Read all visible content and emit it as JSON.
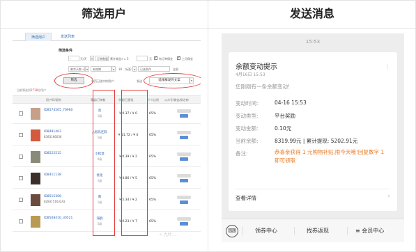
{
  "headers": {
    "left": "筛选用户",
    "right": "发送消息"
  },
  "admin": {
    "tabs": [
      "筛选用户",
      "发送列表"
    ],
    "section_title": "筛选条件",
    "fields": {
      "f1": "-",
      "f1_suffix": "元/天",
      "f2": "订单数量",
      "f2_label": "累计收益>= 5",
      "chk_label_1": "有订单佣金",
      "chk_label_2": "上月佣金",
      "f3": "剩余天数 <",
      "f4": "有效期",
      "f4_label": "已选条件",
      "f5": "30",
      "f6": "标签:",
      "f7": "全部"
    },
    "filter_button": "筛选",
    "filter_hint": "本页已选中的用户:",
    "send_label": "发送",
    "send_button": "选择群发的文案",
    "count_prefix": "当前筛选到",
    "count_value": "2718",
    "count_suffix": "位用户",
    "columns": [
      "用户ID/昵称",
      "等级/订单数",
      "余额/已提现",
      "个人比例",
      "公众号/微信/群名称"
    ],
    "rows": [
      {
        "id": "ID8574565_70960",
        "name": "",
        "level": "高",
        "orders": "1级",
        "balance": "¥ 9.37 / ¥ 0",
        "pct": "65%",
        "avatar": "#c7a08a"
      },
      {
        "id": "ID8491463",
        "name": "8383166036",
        "level": "入股队团队",
        "orders": "5级",
        "balance": "¥ 11.72 / ¥ 0",
        "pct": "65%",
        "avatar": "#d35a3e"
      },
      {
        "id": "ID8522515",
        "name": "",
        "level": "小松鼠",
        "orders": "0级",
        "balance": "¥ 0.39 / ¥ 2",
        "pct": "65%",
        "avatar": "#8a8a7a"
      },
      {
        "id": "ID8411138",
        "name": "",
        "level": "优化",
        "orders": "1级",
        "balance": "¥ 4.86 / ¥ 5",
        "pct": "65%",
        "avatar": "#3c2e2a"
      },
      {
        "id": "ID8515308",
        "name": "8283151632A2",
        "level": "南",
        "orders": "1级",
        "balance": "¥ 5.34 / ¥ 2",
        "pct": "65%",
        "avatar": "#6b4b3e"
      },
      {
        "id": "ID8508410_30521",
        "name": "",
        "level": "海鸥",
        "orders": "5级",
        "balance": "¥ 0.23 / ¥ 7",
        "pct": "65%",
        "avatar": "#b89a54"
      }
    ],
    "watermark": "✧ 九叶..."
  },
  "message": {
    "time": "15:53",
    "title": "余额变动提示",
    "date": "4月16日 15:53",
    "desc": "您刚刚有一条余额变动!",
    "fields": [
      {
        "label": "变动时间:",
        "value": "04-16 15:53"
      },
      {
        "label": "变动类型:",
        "value": "平台奖励"
      },
      {
        "label": "变动金额:",
        "value": "0.10元"
      },
      {
        "label": "当前余额:",
        "value": "8319.99元 | 累计提现: 5202.91元"
      },
      {
        "label": "备注:",
        "value": "恭喜亲获得 1 元购物补贴,限今天哦!回复数字 1 即可领取"
      }
    ],
    "detail": "查看详情",
    "menu": [
      "领券中心",
      "找券返现",
      "≡ 会员中心"
    ]
  },
  "colors": {
    "accent_red": "#e23b3b",
    "link_blue": "#2f64b2",
    "remark_orange": "#e87a25"
  }
}
